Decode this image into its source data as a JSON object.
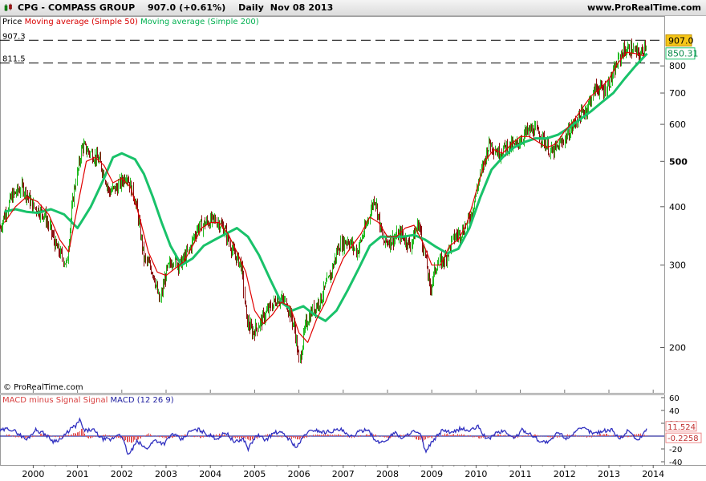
{
  "header": {
    "title": "CPG - COMPASS GROUP    907.0 (+0.61%)    Daily  Nov 08 2013",
    "site": "www.ProRealTime.com"
  },
  "legend": {
    "price": "Price",
    "ma50": "Moving average (Simple 50)",
    "ma200": "Moving average (Simple 200)"
  },
  "macd_legend": {
    "hist": "MACD minus Signal Signal",
    "macd": "MACD (12 26 9)"
  },
  "watermark": "© ProRealTime.com",
  "colors": {
    "up": "#22bb22",
    "down": "#8b1010",
    "ma50": "#e00000",
    "ma200": "#19c26a",
    "macd": "#3030c0",
    "hist": "#e05050",
    "highlight": "#f5c518"
  },
  "chart_data": [
    {
      "type": "line",
      "title": "CPG - COMPASS GROUP",
      "scale": "log",
      "ylim": [
        160,
        960
      ],
      "xlim": [
        1999.25,
        2014.25
      ],
      "yticks": [
        200,
        300,
        400,
        500,
        600,
        700,
        800
      ],
      "xticks": [
        "2000",
        "2001",
        "2002",
        "2003",
        "2004",
        "2005",
        "2006",
        "2007",
        "2008",
        "2009",
        "2010",
        "2011",
        "2012",
        "2013",
        "2014"
      ],
      "hlines": [
        {
          "value": 907.3,
          "label": "907.3"
        },
        {
          "value": 811.5,
          "label": "811.5"
        }
      ],
      "last_price": {
        "value": 907.0,
        "label": "907.0"
      },
      "last_ma": {
        "value": 850.31,
        "label": "850.31"
      },
      "series": [
        {
          "name": "Price",
          "x": [
            1999.25,
            1999.5,
            1999.75,
            2000.0,
            2000.25,
            2000.5,
            2000.75,
            2000.9,
            2001.1,
            2001.3,
            2001.5,
            2001.7,
            2001.9,
            2002.1,
            2002.3,
            2002.5,
            2002.7,
            2002.85,
            2003.0,
            2003.15,
            2003.3,
            2003.5,
            2003.7,
            2003.9,
            2004.1,
            2004.3,
            2004.5,
            2004.7,
            2004.8,
            2004.95,
            2005.1,
            2005.3,
            2005.5,
            2005.7,
            2005.9,
            2006.0,
            2006.15,
            2006.3,
            2006.5,
            2006.7,
            2006.9,
            2007.1,
            2007.3,
            2007.5,
            2007.7,
            2007.9,
            2008.1,
            2008.3,
            2008.5,
            2008.7,
            2008.85,
            2008.95,
            2009.1,
            2009.3,
            2009.5,
            2009.7,
            2009.9,
            2010.1,
            2010.3,
            2010.5,
            2010.7,
            2010.9,
            2011.1,
            2011.3,
            2011.5,
            2011.7,
            2011.9,
            2012.1,
            2012.3,
            2012.5,
            2012.7,
            2012.9,
            2013.1,
            2013.3,
            2013.5,
            2013.7,
            2013.86
          ],
          "values": [
            360,
            420,
            440,
            400,
            385,
            330,
            300,
            420,
            540,
            520,
            500,
            430,
            440,
            470,
            410,
            310,
            290,
            250,
            290,
            310,
            300,
            320,
            360,
            370,
            375,
            360,
            320,
            300,
            230,
            215,
            225,
            240,
            255,
            250,
            220,
            185,
            225,
            240,
            255,
            285,
            330,
            340,
            320,
            360,
            420,
            335,
            340,
            350,
            330,
            370,
            310,
            265,
            300,
            310,
            345,
            355,
            390,
            470,
            550,
            520,
            540,
            540,
            575,
            585,
            560,
            520,
            545,
            580,
            620,
            650,
            720,
            710,
            770,
            860,
            870,
            840,
            907
          ]
        },
        {
          "name": "Moving average (Simple 50)",
          "x": [
            1999.35,
            1999.6,
            1999.85,
            2000.1,
            2000.35,
            2000.6,
            2000.8,
            2001.0,
            2001.2,
            2001.4,
            2001.6,
            2001.8,
            2002.0,
            2002.2,
            2002.4,
            2002.6,
            2002.8,
            2003.0,
            2003.2,
            2003.4,
            2003.6,
            2003.8,
            2004.0,
            2004.2,
            2004.4,
            2004.6,
            2004.8,
            2005.0,
            2005.2,
            2005.4,
            2005.6,
            2005.8,
            2006.0,
            2006.2,
            2006.4,
            2006.6,
            2006.8,
            2007.0,
            2007.2,
            2007.4,
            2007.6,
            2007.8,
            2008.0,
            2008.2,
            2008.4,
            2008.6,
            2008.8,
            2009.0,
            2009.2,
            2009.4,
            2009.6,
            2009.8,
            2010.0,
            2010.2,
            2010.4,
            2010.6,
            2010.8,
            2011.0,
            2011.2,
            2011.4,
            2011.6,
            2011.8,
            2012.0,
            2012.2,
            2012.4,
            2012.6,
            2012.8,
            2013.0,
            2013.2,
            2013.4,
            2013.6,
            2013.8
          ],
          "values": [
            370,
            400,
            420,
            410,
            385,
            340,
            320,
            400,
            500,
            510,
            490,
            450,
            460,
            440,
            380,
            320,
            290,
            285,
            295,
            305,
            330,
            360,
            370,
            370,
            350,
            320,
            290,
            240,
            225,
            235,
            250,
            245,
            215,
            205,
            230,
            250,
            280,
            310,
            330,
            350,
            380,
            370,
            345,
            345,
            360,
            365,
            335,
            300,
            300,
            330,
            340,
            370,
            430,
            500,
            530,
            520,
            545,
            565,
            565,
            550,
            535,
            545,
            580,
            610,
            650,
            690,
            715,
            750,
            810,
            855,
            850,
            840
          ]
        },
        {
          "name": "Moving average (Simple 200)",
          "x": [
            1999.35,
            1999.6,
            1999.85,
            2000.1,
            2000.4,
            2000.7,
            2001.0,
            2001.3,
            2001.6,
            2001.8,
            2002.0,
            2002.3,
            2002.5,
            2002.7,
            2002.9,
            2003.1,
            2003.35,
            2003.6,
            2003.85,
            2004.1,
            2004.35,
            2004.6,
            2004.85,
            2005.1,
            2005.35,
            2005.6,
            2005.85,
            2006.1,
            2006.35,
            2006.6,
            2006.85,
            2007.1,
            2007.35,
            2007.6,
            2007.85,
            2008.1,
            2008.35,
            2008.6,
            2008.85,
            2009.1,
            2009.35,
            2009.6,
            2009.85,
            2010.1,
            2010.35,
            2010.6,
            2010.85,
            2011.1,
            2011.35,
            2011.6,
            2011.85,
            2012.1,
            2012.35,
            2012.6,
            2012.85,
            2013.1,
            2013.35,
            2013.6,
            2013.86
          ],
          "values": [
            390,
            395,
            390,
            388,
            395,
            385,
            360,
            400,
            460,
            510,
            520,
            505,
            470,
            420,
            370,
            330,
            300,
            310,
            330,
            340,
            350,
            360,
            345,
            315,
            280,
            250,
            240,
            245,
            235,
            228,
            240,
            265,
            295,
            330,
            345,
            345,
            345,
            348,
            340,
            328,
            318,
            325,
            360,
            420,
            480,
            510,
            535,
            550,
            560,
            560,
            570,
            590,
            615,
            640,
            670,
            700,
            750,
            800,
            850
          ]
        }
      ]
    },
    {
      "type": "line",
      "title": "MACD (12 26 9)",
      "ylim": [
        -45,
        65
      ],
      "yticks": [
        60,
        40,
        20,
        0,
        -20,
        -40
      ],
      "last_values": [
        {
          "name": "MACD (12 26 9)",
          "value": 11.524,
          "label": "11.524"
        },
        {
          "name": "MACD minus Signal Signal",
          "value": -0.2258,
          "label": "-0.2258"
        }
      ],
      "series": [
        {
          "name": "MACD (12 26 9)",
          "x": [
            1999.25,
            1999.45,
            1999.65,
            1999.85,
            2000.05,
            2000.25,
            2000.45,
            2000.65,
            2000.85,
            2000.95,
            2001.05,
            2001.15,
            2001.35,
            2001.55,
            2001.75,
            2001.95,
            2002.05,
            2002.15,
            2002.35,
            2002.55,
            2002.75,
            2002.95,
            2003.15,
            2003.35,
            2003.55,
            2003.75,
            2003.95,
            2004.15,
            2004.35,
            2004.55,
            2004.75,
            2004.85,
            2005.05,
            2005.25,
            2005.45,
            2005.65,
            2005.85,
            2005.95,
            2006.15,
            2006.35,
            2006.55,
            2006.75,
            2006.95,
            2007.15,
            2007.35,
            2007.55,
            2007.75,
            2007.95,
            2008.15,
            2008.35,
            2008.55,
            2008.75,
            2008.85,
            2009.05,
            2009.25,
            2009.45,
            2009.65,
            2009.85,
            2010.05,
            2010.25,
            2010.45,
            2010.65,
            2010.85,
            2011.05,
            2011.25,
            2011.45,
            2011.65,
            2011.85,
            2012.05,
            2012.25,
            2012.45,
            2012.65,
            2012.85,
            2013.05,
            2013.25,
            2013.45,
            2013.65,
            2013.86
          ],
          "values": [
            8,
            12,
            5,
            -6,
            10,
            4,
            -8,
            -4,
            12,
            15,
            25,
            8,
            10,
            -4,
            -6,
            5,
            -10,
            -30,
            -8,
            -20,
            -6,
            -12,
            4,
            -6,
            8,
            10,
            2,
            -4,
            6,
            -10,
            -4,
            -20,
            2,
            -6,
            6,
            4,
            -10,
            -18,
            4,
            10,
            6,
            8,
            10,
            -2,
            6,
            12,
            -10,
            -8,
            6,
            -4,
            8,
            2,
            -24,
            -6,
            10,
            4,
            12,
            8,
            15,
            -6,
            5,
            8,
            -4,
            10,
            2,
            -8,
            -10,
            6,
            -4,
            8,
            12,
            4,
            8,
            10,
            -4,
            10,
            -8,
            11.524
          ]
        },
        {
          "name": "MACD minus Signal Signal",
          "x": [
            1999.4,
            1999.8,
            2000.2,
            2000.6,
            2001.0,
            2001.1,
            2001.2,
            2001.6,
            2002.0,
            2002.2,
            2002.6,
            2003.0,
            2003.4,
            2003.8,
            2004.2,
            2004.6,
            2004.9,
            2005.3,
            2005.7,
            2006.0,
            2006.4,
            2006.8,
            2007.2,
            2007.6,
            2008.0,
            2008.4,
            2008.8,
            2008.9,
            2009.3,
            2009.7,
            2010.1,
            2010.5,
            2010.9,
            2011.3,
            2011.7,
            2012.1,
            2012.5,
            2012.9,
            2013.3,
            2013.7,
            2013.86
          ],
          "values": [
            2,
            -3,
            3,
            -2,
            6,
            12,
            -4,
            2,
            -5,
            -10,
            3,
            -3,
            2,
            -2,
            3,
            -3,
            -6,
            2,
            -2,
            -5,
            3,
            2,
            -2,
            3,
            -3,
            2,
            -8,
            -4,
            3,
            2,
            -3,
            3,
            -2,
            2,
            -3,
            2,
            -2,
            3,
            -2,
            3,
            -0.2258
          ]
        }
      ]
    }
  ]
}
